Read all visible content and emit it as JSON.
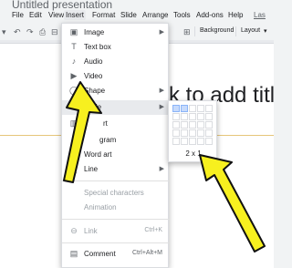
{
  "window": {
    "title": "Untitled presentation"
  },
  "menubar": {
    "items": [
      "File",
      "Edit",
      "View",
      "Insert",
      "Format",
      "Slide",
      "Arrange",
      "Tools",
      "Add-ons",
      "Help"
    ],
    "right_text": "Las"
  },
  "toolbar": {
    "background_label": "Background",
    "layout_label": "Layout",
    "layout_caret": "▾"
  },
  "slide": {
    "placeholder": "k to add title"
  },
  "insert_menu": {
    "items": [
      {
        "icon": "image-icon",
        "glyph": "▣",
        "label": "Image",
        "submenu": true,
        "disabled": false
      },
      {
        "icon": "text-box-icon",
        "glyph": "T",
        "label": "Text box",
        "disabled": false
      },
      {
        "icon": "audio-icon",
        "glyph": "♪",
        "label": "Audio",
        "disabled": false
      },
      {
        "icon": "video-icon",
        "glyph": "▶",
        "label": "Video",
        "disabled": false
      },
      {
        "icon": "shape-icon",
        "glyph": "◯",
        "label": "Shape",
        "submenu": true,
        "disabled": false
      },
      {
        "icon": "table-icon",
        "glyph": "",
        "label": "Table",
        "submenu": true,
        "highlighted": true,
        "disabled": false
      },
      {
        "icon": "chart-icon",
        "glyph": "▥",
        "label": "rt",
        "disabled": false
      },
      {
        "icon": "diagram-icon",
        "glyph": "⁘",
        "label": "gram",
        "disabled": false
      },
      {
        "icon": "word-art-icon",
        "glyph": "A",
        "label": "Word art",
        "disabled": false
      },
      {
        "icon": "line-icon",
        "glyph": "╲",
        "label": "Line",
        "submenu": true,
        "disabled": false
      },
      {
        "icon": "special-characters-icon",
        "glyph": "",
        "label": "Special characters",
        "disabled": true
      },
      {
        "icon": "animation-icon",
        "glyph": "",
        "label": "Animation",
        "disabled": true
      },
      {
        "icon": "link-icon",
        "glyph": "⊖",
        "label": "Link",
        "shortcut": "Ctrl+K",
        "disabled": true
      },
      {
        "icon": "comment-icon",
        "glyph": "▤",
        "label": "Comment",
        "shortcut": "Ctrl+Alt+M",
        "disabled": false
      }
    ]
  },
  "table_submenu": {
    "size_label": "2 x 1"
  },
  "colors": {
    "arrow_fill": "#f7f01f",
    "arrow_stroke": "#111111",
    "highlight": "#e8eaed",
    "grid_selected": "#c6dafc"
  }
}
